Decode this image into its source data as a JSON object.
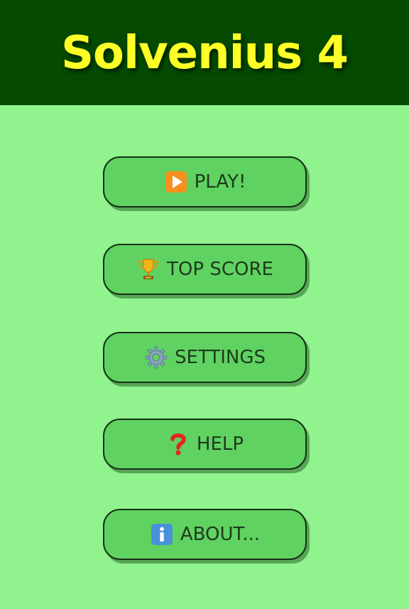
{
  "app": {
    "title": "Solvenius 4"
  },
  "menu": {
    "items": [
      {
        "label": "PLAY!",
        "icon": "play-icon"
      },
      {
        "label": "TOP SCORE",
        "icon": "trophy-icon"
      },
      {
        "label": "SETTINGS",
        "icon": "gear-icon"
      },
      {
        "label": "HELP",
        "icon": "question-mark-icon"
      },
      {
        "label": "ABOUT...",
        "icon": "info-icon"
      }
    ]
  },
  "colors": {
    "header_background": "#044a00",
    "title_text": "#ffff28",
    "page_background": "#90f38e",
    "button_fill": "#5fd262",
    "button_border": "#163014",
    "button_text": "#1d3a1b"
  }
}
